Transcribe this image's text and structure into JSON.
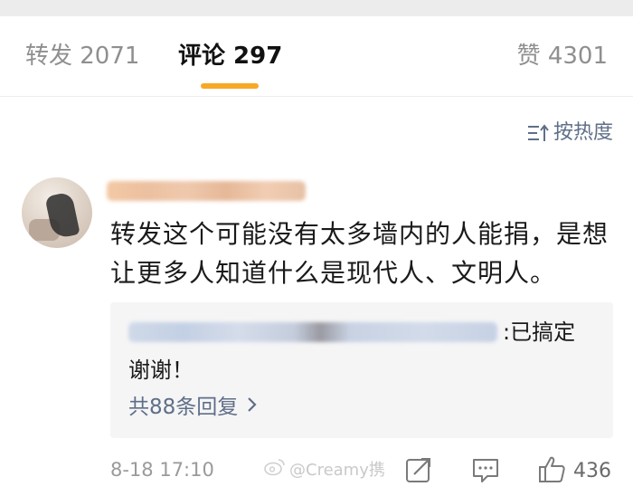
{
  "tabs": {
    "repost": "转发 2071",
    "comment": "评论 297",
    "like": "赞 4301"
  },
  "sort_label": "按热度",
  "comment": {
    "text": "转发这个可能没有太多墙内的人能捐，是想让更多人知道什么是现代人、文明人。"
  },
  "reply": {
    "suffix": ":已搞定",
    "line2": "谢谢！",
    "more_label": "共88条回复"
  },
  "footer": {
    "date": "8-18 17:10",
    "watermark": "@Creamy携",
    "like_count": "436"
  },
  "colors": {
    "accent": "#f7a825",
    "link": "#5f6f88"
  }
}
